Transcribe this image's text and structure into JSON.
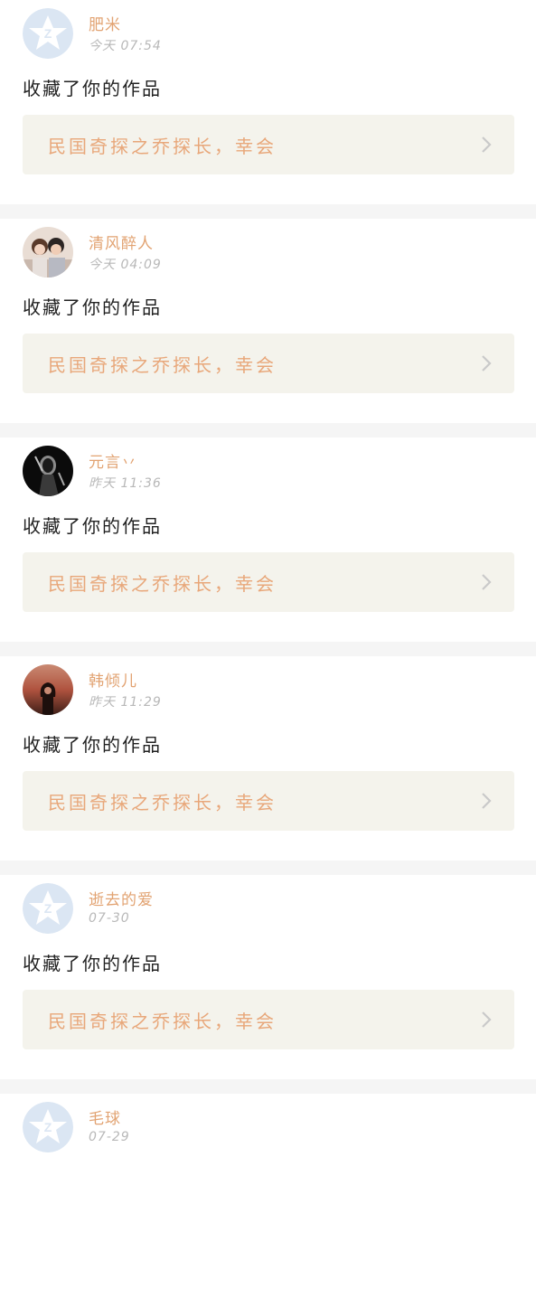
{
  "feed": {
    "items": [
      {
        "username": "肥米",
        "time": "今天 07:54",
        "action": "收藏了你的作品",
        "work_title": "民国奇探之乔探长，幸会",
        "avatar_type": "default"
      },
      {
        "username": "清风醉人",
        "time": "今天 04:09",
        "action": "收藏了你的作品",
        "work_title": "民国奇探之乔探长，幸会",
        "avatar_type": "photo-couple"
      },
      {
        "username": "元言丷",
        "time": "昨天 11:36",
        "action": "收藏了你的作品",
        "work_title": "民国奇探之乔探长，幸会",
        "avatar_type": "photo-dark"
      },
      {
        "username": "韩倾儿",
        "time": "昨天 11:29",
        "action": "收藏了你的作品",
        "work_title": "民国奇探之乔探长，幸会",
        "avatar_type": "photo-sunset"
      },
      {
        "username": "逝去的爱",
        "time": "07-30",
        "action": "收藏了你的作品",
        "work_title": "民国奇探之乔探长，幸会",
        "avatar_type": "default"
      },
      {
        "username": "毛球",
        "time": "07-29",
        "action": "",
        "work_title": "",
        "avatar_type": "default"
      }
    ]
  },
  "colors": {
    "username": "#e2a372",
    "work_title": "#e8a77a",
    "time": "#b8b8b8",
    "card_bg": "#f4f3ec",
    "divider": "#f5f5f5",
    "default_avatar": "#dbe6f3"
  }
}
